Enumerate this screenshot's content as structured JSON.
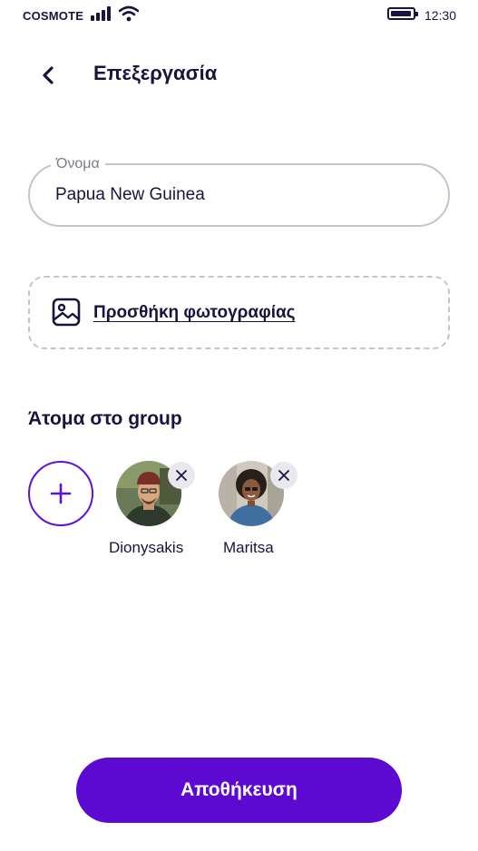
{
  "status_bar": {
    "carrier": "COSMOTE",
    "time": "12:30"
  },
  "header": {
    "title": "Επεξεργασία"
  },
  "name_field": {
    "label": "Όνομα",
    "value": "Papua New Guinea"
  },
  "add_photo": {
    "label": "Προσθήκη φωτογραφίας"
  },
  "group": {
    "title": "Άτομα στο group",
    "members": [
      {
        "name": "Dionysakis"
      },
      {
        "name": "Maritsa"
      }
    ]
  },
  "save_button": {
    "label": "Αποθήκευση"
  },
  "colors": {
    "primary": "#5c0ad2",
    "text": "#1b1240",
    "border": "#c5c3ce"
  }
}
